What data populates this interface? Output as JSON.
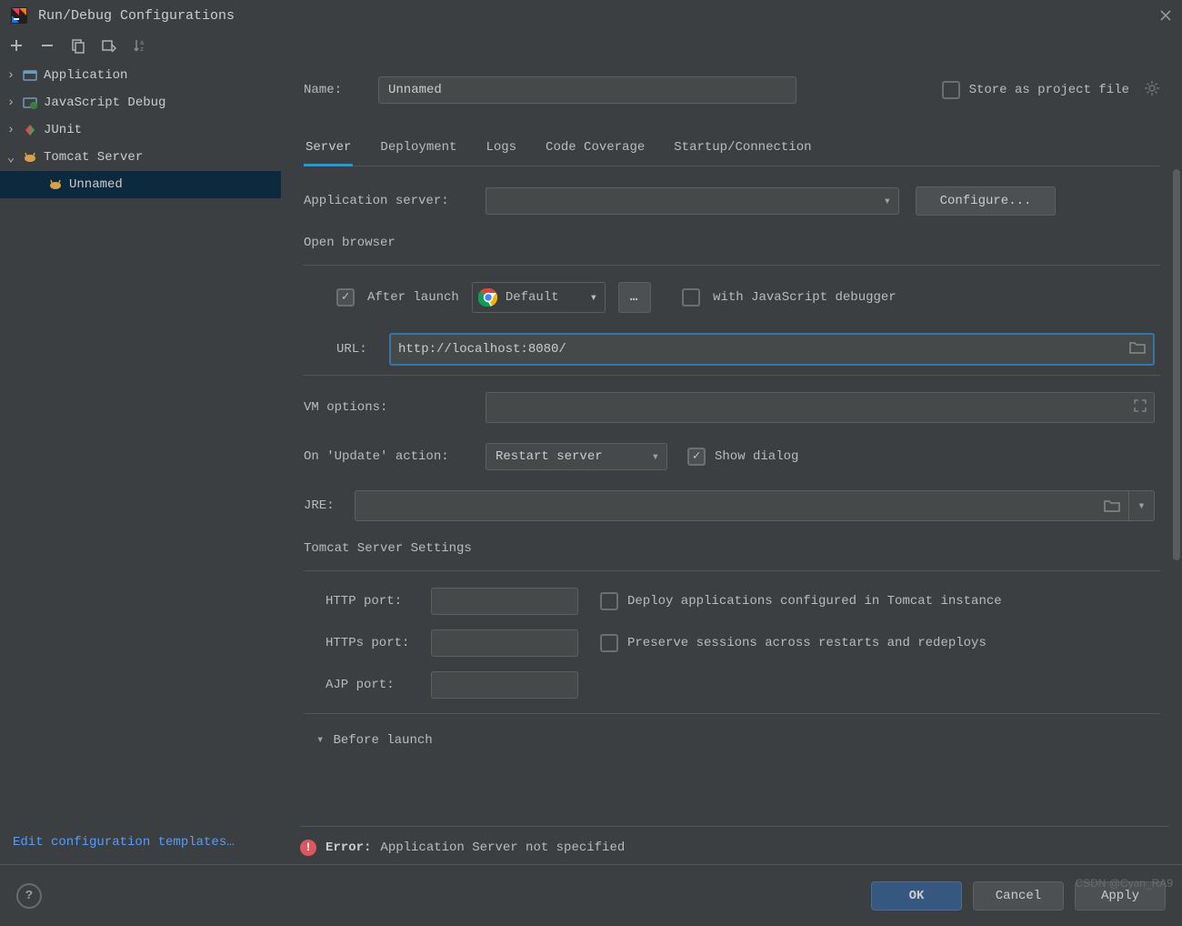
{
  "window": {
    "title": "Run/Debug Configurations"
  },
  "sidebar": {
    "items": [
      {
        "label": "Application"
      },
      {
        "label": "JavaScript Debug"
      },
      {
        "label": "JUnit"
      },
      {
        "label": "Tomcat Server"
      }
    ],
    "child": {
      "label": "Unnamed"
    },
    "edit_templates": "Edit configuration templates…"
  },
  "form": {
    "name_label": "Name:",
    "name_value": "Unnamed",
    "store_label": "Store as project file",
    "tabs": [
      "Server",
      "Deployment",
      "Logs",
      "Code Coverage",
      "Startup/Connection"
    ],
    "app_server_label": "Application server:",
    "configure_btn": "Configure...",
    "open_browser_label": "Open browser",
    "after_launch_label": "After launch",
    "browser_default": "Default",
    "with_js_debugger": "with JavaScript debugger",
    "url_label": "URL:",
    "url_value": "http://localhost:8080/",
    "vm_label": "VM options:",
    "on_update_label": "On 'Update' action:",
    "on_update_value": "Restart server",
    "show_dialog": "Show dialog",
    "jre_label": "JRE:",
    "tomcat_settings": "Tomcat Server Settings",
    "http_port": "HTTP port:",
    "https_port": "HTTPs port:",
    "ajp_port": "AJP port:",
    "deploy_apps": "Deploy applications configured in Tomcat instance",
    "preserve_sessions": "Preserve sessions across restarts and redeploys",
    "before_launch": "Before launch"
  },
  "error": {
    "label": "Error:",
    "message": "Application Server not specified"
  },
  "buttons": {
    "ok": "OK",
    "cancel": "Cancel",
    "apply": "Apply"
  },
  "watermark": "CSDN @Cyan_RA9"
}
